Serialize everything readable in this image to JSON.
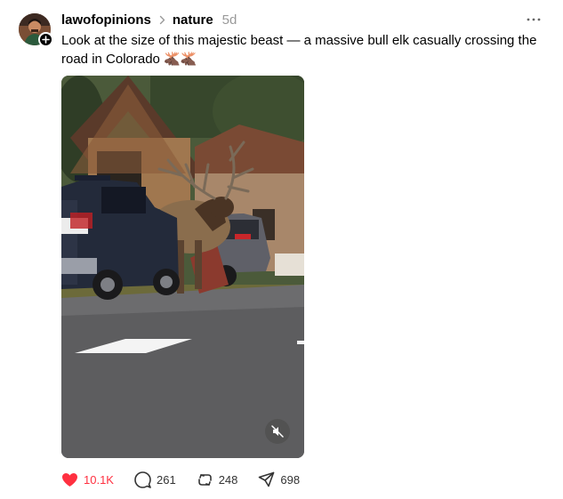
{
  "post": {
    "author": {
      "username": "lawofopinions",
      "avatar_icon": "user-avatar"
    },
    "topic": "nature",
    "time": "5d",
    "caption": "Look at the size of this majestic beast — a massive bull elk casually crossing the road in Colorado 🫎🫎",
    "media": {
      "type": "video",
      "muted": true,
      "mute_icon": "speaker-muted-icon"
    },
    "actions": {
      "likes": "10.1K",
      "liked": true,
      "replies": "261",
      "reposts": "248",
      "shares": "698"
    }
  },
  "colors": {
    "like_accent": "#ff3040",
    "muted_text": "#999999",
    "text": "#000000"
  }
}
